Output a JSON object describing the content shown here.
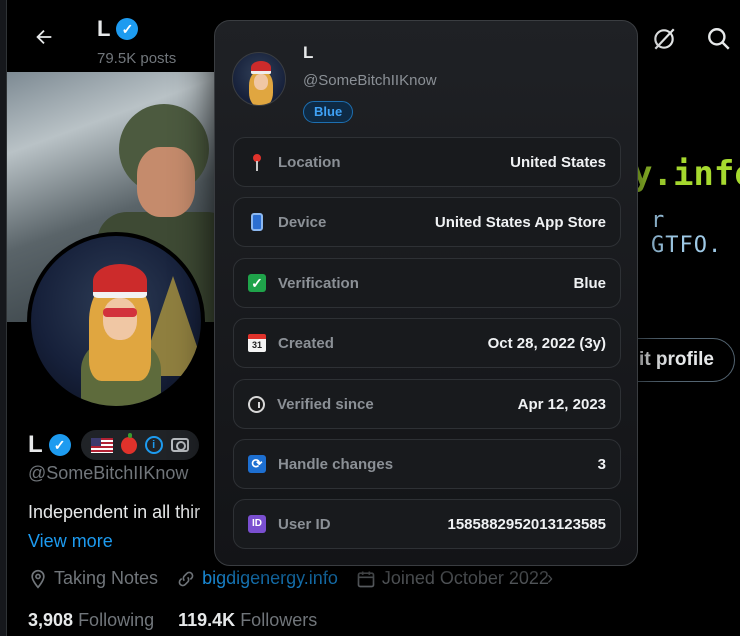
{
  "header": {
    "name": "L",
    "posts": "79.5K posts",
    "back_icon": "arrow-left-icon",
    "grok_icon": "grok-icon",
    "search_icon": "search-icon"
  },
  "banner": {
    "text_line1": "y.info",
    "text_line2": "r GTFO."
  },
  "profile": {
    "name": "L",
    "handle": "@SomeBitchIIKnow",
    "edit_button": "it profile",
    "bio": "Independent in all thir",
    "view_more": "View more",
    "badges": [
      "us-flag-icon",
      "apple-icon",
      "info-icon",
      "camera-icon"
    ],
    "meta": {
      "location": "Taking Notes",
      "website": "bigdigenergy.info",
      "joined": "Joined October 2022"
    },
    "following_count": "3,908",
    "following_label": "Following",
    "followers_count": "119.4K",
    "followers_label": "Followers"
  },
  "popup": {
    "name": "L",
    "handle": "@SomeBitchIIKnow",
    "tier": "Blue",
    "rows": [
      {
        "label": "Location",
        "value": "United States",
        "icon": "pin-icon"
      },
      {
        "label": "Device",
        "value": "United States App Store",
        "icon": "phone-icon"
      },
      {
        "label": "Verification",
        "value": "Blue",
        "icon": "checkmark-icon"
      },
      {
        "label": "Created",
        "value": "Oct 28, 2022 (3y)",
        "icon": "calendar-icon"
      },
      {
        "label": "Verified since",
        "value": "Apr 12, 2023",
        "icon": "stopwatch-icon"
      },
      {
        "label": "Handle changes",
        "value": "3",
        "icon": "cycle-icon"
      },
      {
        "label": "User ID",
        "value": "1585882952013123585",
        "icon": "id-icon"
      }
    ]
  },
  "colors": {
    "accent": "#1d9bf0",
    "banner_green": "#a6d92f",
    "background": "#000000"
  }
}
